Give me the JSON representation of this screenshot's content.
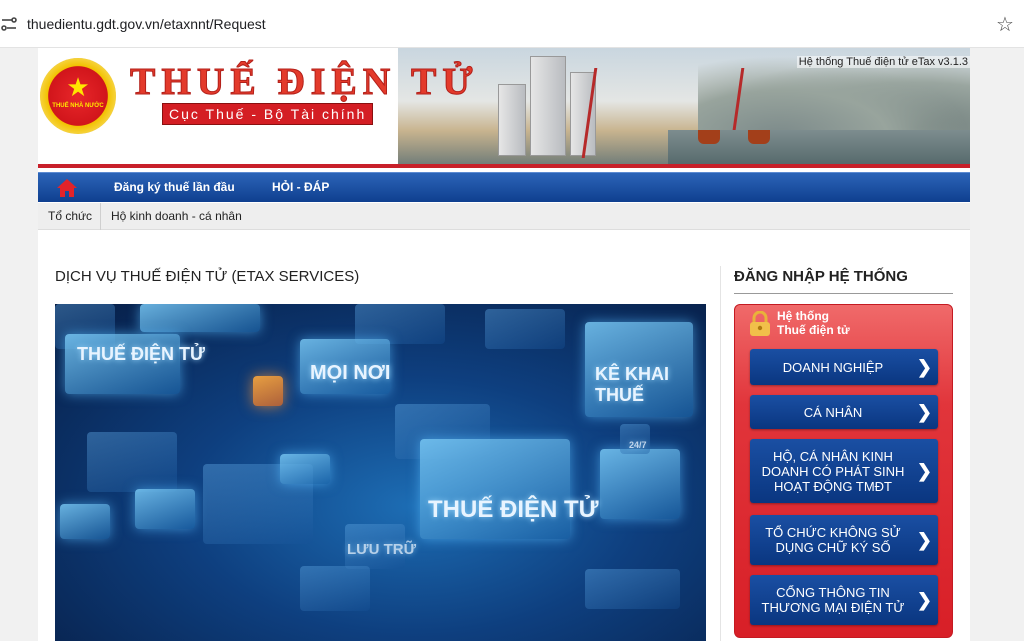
{
  "browser": {
    "url": "thuedientu.gdt.gov.vn/etaxnnt/Request"
  },
  "header": {
    "emblem_text": "THUẾ NHÀ NƯỚC",
    "brand": "THUẾ ĐIỆN TỬ",
    "subtitle": "Cục Thuế - Bộ Tài chính",
    "version": "Hệ thống Thuế điện tử eTax v3.1.3"
  },
  "nav": {
    "items": [
      "Đăng ký thuế lần đầu",
      "HỎI - ĐÁP"
    ]
  },
  "subnav": {
    "items": [
      "Tổ chức",
      "Hộ kinh doanh - cá nhân"
    ]
  },
  "main": {
    "title": "DỊCH VỤ THUẾ ĐIỆN TỬ (ETAX SERVICES)",
    "hero_texts": [
      "THUẾ ĐIỆN TỬ",
      "MỌI NƠI",
      "KÊ KHAI THUẾ",
      "THUẾ ĐIỆN TỬ",
      "LƯU TRỮ",
      "24/7"
    ]
  },
  "sidebar": {
    "title": "ĐĂNG NHẬP HỆ THỐNG",
    "panel_title_line1": "Hệ thống",
    "panel_title_line2": "Thuế điện tử",
    "buttons": [
      {
        "label": "DOANH NGHIỆP"
      },
      {
        "label": "CÁ NHÂN"
      },
      {
        "label": "HỘ, CÁ NHÂN KINH DOANH CÓ PHÁT SINH HOẠT ĐỘNG TMĐT"
      },
      {
        "label": "TỔ CHỨC KHÔNG SỬ DỤNG CHỮ KÝ SỐ"
      },
      {
        "label": "CỔNG THÔNG TIN THƯƠNG MẠI ĐIỆN TỬ"
      }
    ]
  },
  "colors": {
    "nav_blue": "#0f3f8f",
    "brand_red": "#d41e24",
    "button_blue": "#0a3680"
  }
}
